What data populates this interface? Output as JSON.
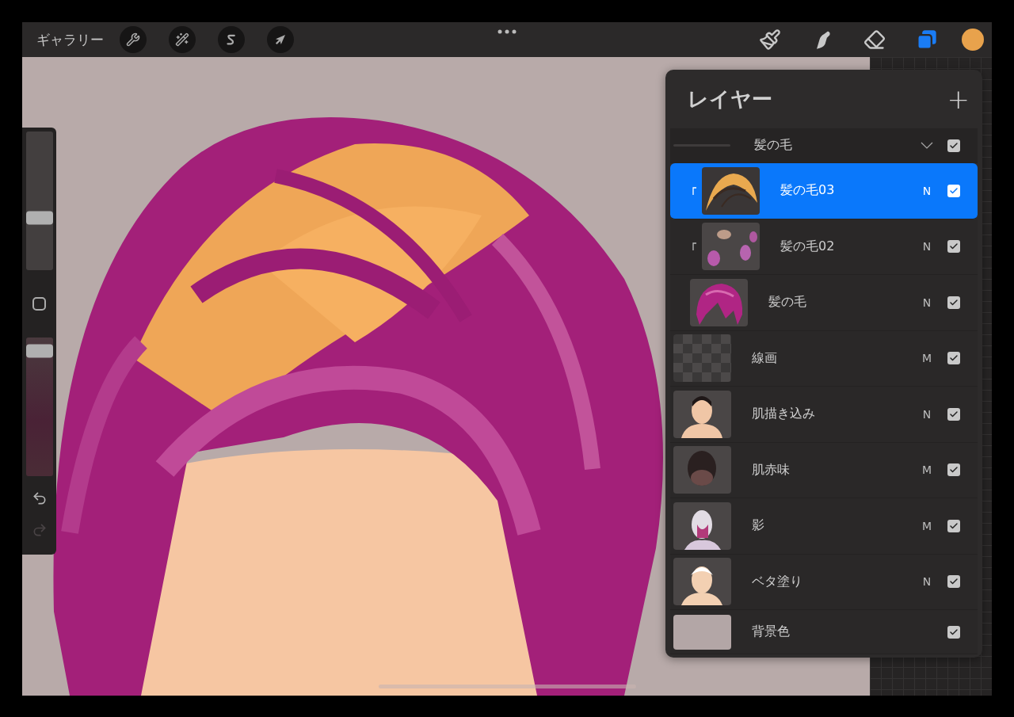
{
  "toolbar": {
    "gallery": "ギャラリー",
    "left_tools": [
      {
        "kind": "wrench"
      },
      {
        "kind": "wand"
      },
      {
        "kind": "selection"
      },
      {
        "kind": "transform"
      }
    ],
    "right_tools": [
      {
        "kind": "brush",
        "selected": false
      },
      {
        "kind": "smudge",
        "selected": false
      },
      {
        "kind": "eraser",
        "selected": false
      },
      {
        "kind": "layers",
        "selected": true
      }
    ],
    "color": "#e8a24c"
  },
  "sidebar": {
    "sliders": [
      {
        "level": 0.38
      },
      {
        "level": 0.95
      }
    ],
    "buttons": [
      {
        "kind": "undo",
        "disabled": false
      },
      {
        "kind": "redo",
        "disabled": true
      }
    ]
  },
  "layers_panel": {
    "title": "レイヤー",
    "add": "+",
    "layers": [
      {
        "kind": "group",
        "name": "髪の毛",
        "expanded": true,
        "visible": true,
        "selected": false,
        "children": [
          {
            "kind": "layer",
            "name": "髪の毛03",
            "blend": "N",
            "visible": true,
            "selected": true,
            "clipped": true
          },
          {
            "kind": "layer",
            "name": "髪の毛02",
            "blend": "N",
            "visible": true,
            "selected": false,
            "clipped": true
          },
          {
            "kind": "layer",
            "name": "髪の毛",
            "blend": "N",
            "visible": true,
            "selected": false,
            "clipped": false
          }
        ]
      },
      {
        "kind": "layer",
        "name": "線画",
        "blend": "M",
        "visible": true,
        "selected": false,
        "clipped": false,
        "thumbnail": {
          "kind": "checker"
        }
      },
      {
        "kind": "layer",
        "name": "肌描き込み",
        "blend": "N",
        "visible": true,
        "selected": false,
        "clipped": false
      },
      {
        "kind": "layer",
        "name": "肌赤味",
        "blend": "M",
        "visible": true,
        "selected": false,
        "clipped": false
      },
      {
        "kind": "layer",
        "name": "影",
        "blend": "M",
        "visible": true,
        "selected": false,
        "clipped": false
      },
      {
        "kind": "layer",
        "name": "ベタ塗り",
        "blend": "N",
        "visible": true,
        "selected": false,
        "clipped": false
      },
      {
        "kind": "layer",
        "name": "背景色",
        "visible": true,
        "selected": false,
        "clipped": false,
        "thumbnail": {
          "kind": "swatch",
          "color": "#b3a6a6"
        }
      }
    ]
  }
}
